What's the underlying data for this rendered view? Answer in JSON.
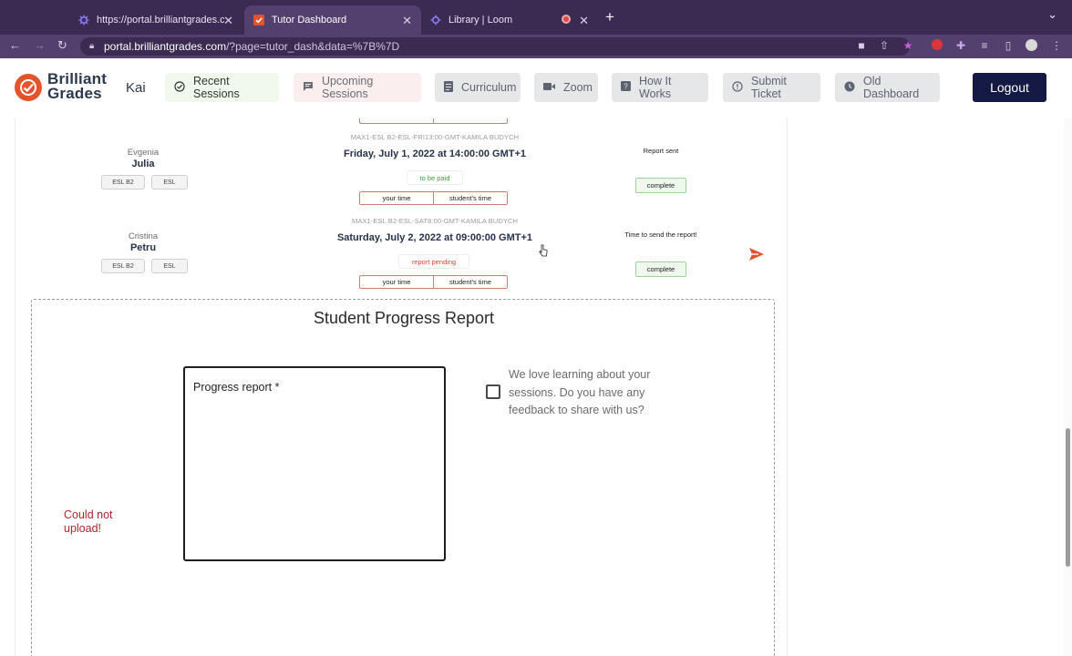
{
  "browser": {
    "tabs": [
      {
        "title": "https://portal.brilliantgrades.co",
        "favicon": "gear-icon"
      },
      {
        "title": "Tutor Dashboard",
        "favicon": "brilliant-grades-icon"
      },
      {
        "title": "Library | Loom",
        "favicon": "loom-icon"
      }
    ],
    "url_host": "portal.brilliantgrades.com",
    "url_path": "/?page=tutor_dash&data=%7B%7D",
    "colors": {
      "chrome": "#3b2a52",
      "chrome_active": "#53406f"
    }
  },
  "header": {
    "logo_line1": "Brilliant",
    "logo_line2": "Grades",
    "user_name": "Kai",
    "nav": {
      "recent": "Recent Sessions",
      "upcoming": "Upcoming Sessions",
      "curriculum": "Curriculum",
      "zoom": "Zoom",
      "how": "How It Works",
      "ticket": "Submit Ticket",
      "old": "Old Dashboard"
    },
    "logout": "Logout",
    "colors": {
      "brand": "#e5532c",
      "logout_bg": "#151a45"
    }
  },
  "sessions": [
    {
      "first_name": "Evgenia",
      "last_name": "Julia",
      "tags": [
        "ESL B2",
        "ESL"
      ],
      "code": "MAX1-ESL B2-ESL-FRI13:00-GMT-KAMILA BUDYCH",
      "when": "Friday, July 1, 2022 at 14:00:00 GMT+1",
      "payment": "to be paid",
      "your_time": "your time",
      "student_time": "student's time",
      "status_text": "Report sent",
      "complete": "complete"
    },
    {
      "first_name": "Cristina",
      "last_name": "Petru",
      "tags": [
        "ESL B2",
        "ESL"
      ],
      "code": "MAX1-ESL B2-ESL-SAT8:00-GMT-KAMILA BUDYCH",
      "when": "Saturday, July 2, 2022 at 09:00:00 GMT+1",
      "payment": "report pending",
      "your_time": "your time",
      "student_time": "student's time",
      "status_text": "Time to send the report!",
      "complete": "complete"
    }
  ],
  "report": {
    "title": "Student Progress Report",
    "error": "Could not upload!",
    "field_label": "Progress report *",
    "feedback_question": "We love learning about your sessions. Do you have any feedback to share with us?",
    "feedback_checked": false
  }
}
